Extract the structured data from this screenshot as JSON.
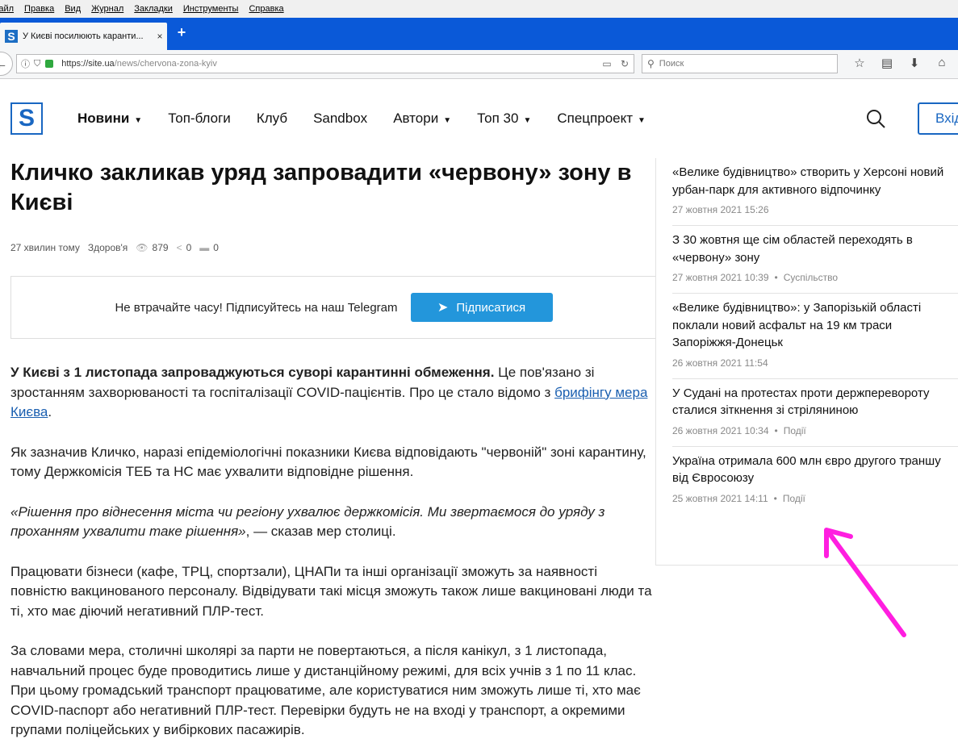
{
  "browser": {
    "menu": [
      "Файл",
      "Правка",
      "Вид",
      "Журнал",
      "Закладки",
      "Инструменты",
      "Справка"
    ],
    "tab_title": "У Києві посилюють каранти...",
    "tab_close": "×",
    "new_tab": "+",
    "url_host": "https://site.ua",
    "url_path": "/news/chervona-zona-kyiv",
    "search_placeholder": "Поиск"
  },
  "site": {
    "logo": "S",
    "nav": [
      {
        "label": "Новини",
        "dropdown": true,
        "active": true
      },
      {
        "label": "Топ-блоги"
      },
      {
        "label": "Клуб"
      },
      {
        "label": "Sandbox"
      },
      {
        "label": "Автори",
        "dropdown": true
      },
      {
        "label": "Топ 30",
        "dropdown": true
      },
      {
        "label": "Спецпроект",
        "dropdown": true
      }
    ],
    "login_label": "Вхід"
  },
  "article": {
    "headline": "Кличко закликав уряд запровадити «червону» зону в Києві",
    "time": "27 хвилин тому",
    "category": "Здоров'я",
    "views": "879",
    "shares": "0",
    "comments": "0",
    "telegram_text": "Не втрачайте часу!  Підписуйтесь на наш Telegram",
    "telegram_button": "Підписатися",
    "p1_bold": "У Києві з 1 листопада запроваджуються суворі карантинні обмеження.",
    "p1_rest": " Це пов'язано зі зростанням захворюваності та госпіталізації COVID-пацієнтів. Про це стало відомо з ",
    "p1_link": "брифінгу мера Києва",
    "p1_end": ".",
    "p2": "Як зазначив Кличко, наразі епідеміологічні показники Києва відповідають \"червоній\" зоні карантину, тому Держкомісія ТЕБ та НС має ухвалити відповідне рішення.",
    "p3_quote": "«Рішення про віднесення міста чи регіону ухвалює держкомісія. Ми звертаємося до уряду з проханням ухвалити таке рішення»",
    "p3_rest": ", — сказав мер столиці.",
    "p4": "Працювати бізнеси (кафе, ТРЦ, спортзали), ЦНАПи та інші організації зможуть за наявності повністю вакцинованого персоналу. Відвідувати такі місця зможуть також лише вакциновані люди та ті, хто має діючий негативний ПЛР-тест.",
    "p5": "За словами мера, столичні школярі за парти не повертаються, а після канікул, з 1 листопада, навчальний процес буде проводитись лише у дистанційному режимі, для всіх учнів з 1 по 11 клас. При цьому громадський транспорт працюватиме, але користуватися ним зможуть лише ті, хто має COVID-паспорт або негативний ПЛР-тест. Перевірки будуть не на вході у транспорт, а окремими групами поліцейських у вибіркових пасажирів."
  },
  "sidebar": {
    "items": [
      {
        "title": "«Велике будівництво» створить у Херсоні новий урбан-парк для активного відпочинку",
        "date": "27 жовтня 2021 15:26",
        "category": ""
      },
      {
        "title": "З 30 жовтня ще сім областей переходять в «червону» зону",
        "date": "27 жовтня 2021 10:39",
        "category": "Суспільство"
      },
      {
        "title": "«Велике будівництво»: у Запорізькій області поклали новий асфальт на 19 км траси Запоріжжя-Донецьк",
        "date": "26 жовтня 2021 11:54",
        "category": ""
      },
      {
        "title": "У Судані на протестах проти держперевороту сталися зіткнення зі стріляниною",
        "date": "26 жовтня 2021 10:34",
        "category": "Події"
      },
      {
        "title": "Україна отримала 600 млн євро другого траншу від Євросоюзу",
        "date": "25 жовтня 2021 14:11",
        "category": "Події"
      }
    ]
  },
  "annotation": {
    "arrow_color": "#ff1ee0"
  }
}
